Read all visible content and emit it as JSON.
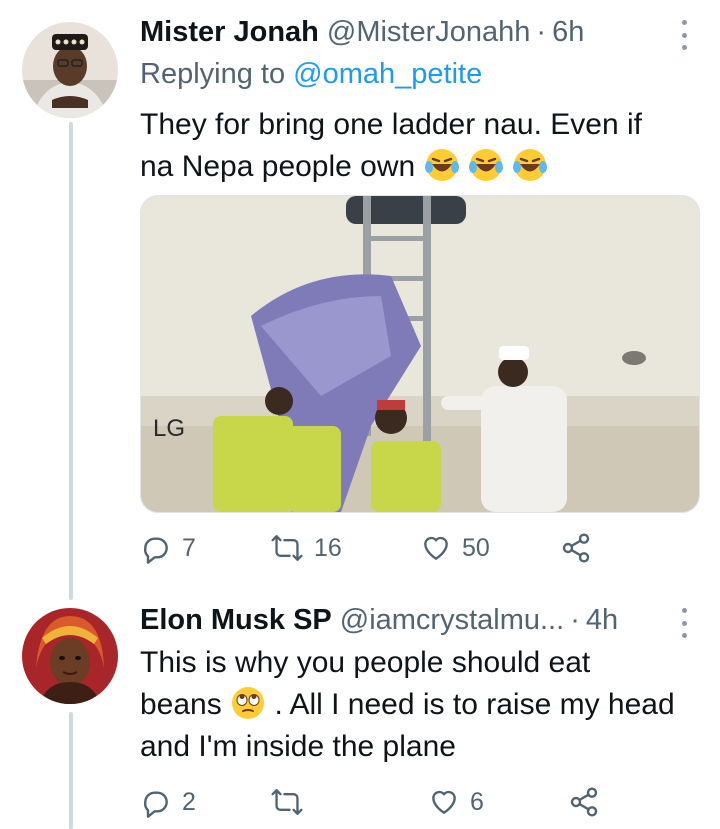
{
  "tweets": [
    {
      "name": "Mister Jonah",
      "handle": "@MisterJonahh",
      "separator": "·",
      "time": "6h",
      "replying_prefix": "Replying to",
      "replying_to": "@omah_petite",
      "text_line1": "They for bring one ladder nau. Even if",
      "text_line2": "na Nepa people own",
      "emoji": "laughing-tears",
      "image_label": "LG",
      "stats": {
        "replies": "7",
        "retweets": "16",
        "likes": "50"
      }
    },
    {
      "name": "Elon Musk SP",
      "handle": "@iamcrystalmu...",
      "separator": "·",
      "time": "4h",
      "text_line1": "This is why you people should eat",
      "text_line2_before": "beans",
      "text_line2_after": ". All I need is to raise my head",
      "text_line3": "and I'm inside the plane",
      "emoji": "eye-roll",
      "stats": {
        "replies": "2",
        "retweets": "",
        "likes": "6"
      }
    }
  ],
  "colors": {
    "text": "#0f1419",
    "secondary": "#536471",
    "link": "#1d9bf0",
    "thread_line": "#cfd9de"
  }
}
